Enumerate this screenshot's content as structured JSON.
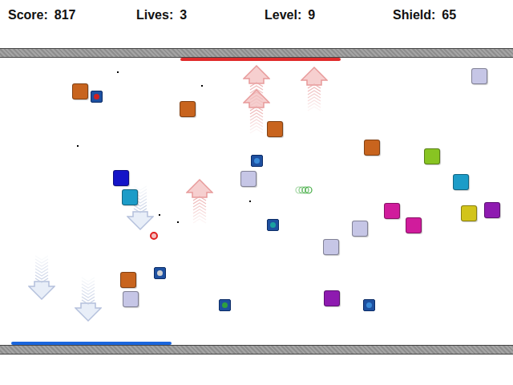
{
  "hud": [
    {
      "label": "Score:",
      "value": "817"
    },
    {
      "label": "Lives:",
      "value": "3"
    },
    {
      "label": "Level:",
      "value": "9"
    },
    {
      "label": "Shield:",
      "value": "65"
    }
  ],
  "paddles": [
    {
      "side": "top",
      "color": "#e02a2a"
    },
    {
      "side": "bottom",
      "color": "#1a66dd"
    }
  ],
  "blocks": [
    {
      "color": "#c8641e"
    },
    {
      "color": "#c8641e"
    },
    {
      "color": "#c8641e"
    },
    {
      "color": "#c8641e"
    },
    {
      "color": "#88c422"
    },
    {
      "color": "#c6c6e6"
    },
    {
      "color": "#1414c8"
    },
    {
      "color": "#1c9cc8"
    },
    {
      "color": "#c6c6e6"
    },
    {
      "color": "#1c9cc8"
    },
    {
      "color": "#d01c9c"
    },
    {
      "color": "#d01c9c"
    },
    {
      "color": "#d2c41a"
    },
    {
      "color": "#8e1ab0"
    },
    {
      "color": "#c6c6e6"
    },
    {
      "color": "#c6c6e6"
    },
    {
      "color": "#c8641e"
    },
    {
      "color": "#c6c6e6"
    },
    {
      "color": "#8e1ab0"
    }
  ],
  "powerups": [
    {
      "color": "#d02020"
    },
    {
      "color": "#3a8ad8"
    },
    {
      "color": "#d0d0d0"
    },
    {
      "color": "#1aa0a0"
    },
    {
      "color": "#3a8ad8"
    },
    {
      "color": "#2ea040"
    }
  ],
  "arrows": [
    {
      "kind": "up"
    },
    {
      "kind": "up"
    },
    {
      "kind": "up"
    },
    {
      "kind": "up"
    },
    {
      "kind": "down"
    },
    {
      "kind": "down"
    },
    {
      "kind": "down"
    }
  ],
  "ball": {
    "color": "#e02020"
  },
  "trail": {
    "color": "#3aa83a"
  }
}
